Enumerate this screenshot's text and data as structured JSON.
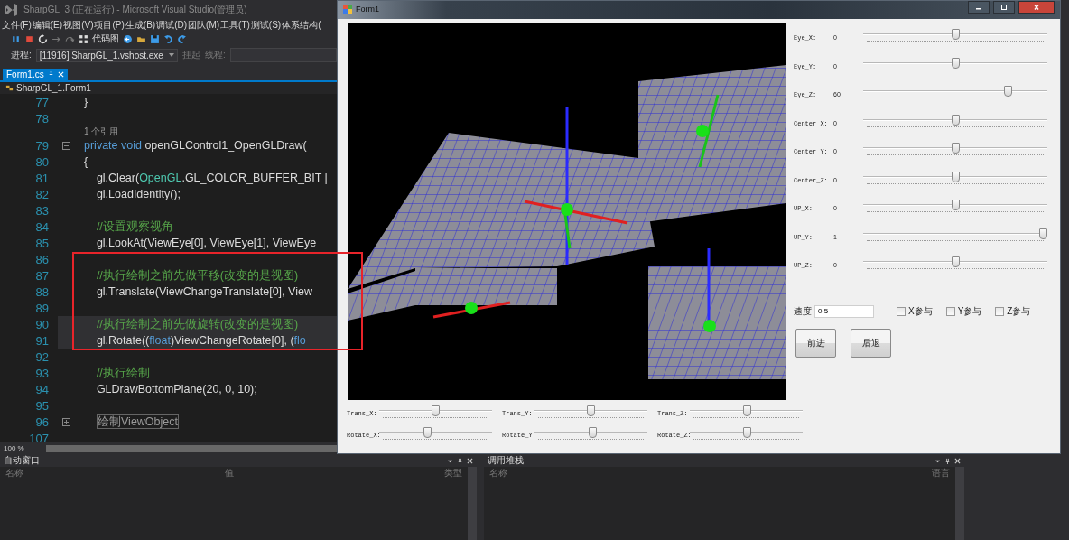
{
  "ide": {
    "title": "SharpGL_3 (正在运行) - Microsoft Visual Studio(管理员)",
    "menu": [
      "文件(F)",
      "编辑(E)",
      "视图(V)",
      "项目(P)",
      "生成(B)",
      "调试(D)",
      "团队(M)",
      "工具(T)",
      "测试(S)",
      "体系结构("
    ],
    "toolbar": {
      "code_map": "代码图"
    },
    "debug_bar": {
      "process_label": "进程:",
      "process": "[11916] SharpGL_1.vshost.exe",
      "suspend": "挂起",
      "thread_label": "线程:"
    },
    "tabs": [
      {
        "label": "Form1.cs",
        "selected": true
      }
    ],
    "breadcrumb": "SharpGL_1.Form1",
    "code_lines": [
      {
        "kind": "code",
        "number": "77",
        "highlighted": false,
        "tokens": [
          {
            "text": "}",
            "kind": "plain"
          }
        ]
      },
      {
        "kind": "code",
        "number": "78",
        "highlighted": false
      },
      {
        "kind": "codelens",
        "text": "1 个引用"
      },
      {
        "kind": "code",
        "number": "79",
        "collapsed": false,
        "highlighted": false,
        "tokens": [
          {
            "text": "private void",
            "kind": "keyword"
          },
          {
            "text": " openGLControl1_OpenGLDraw(",
            "kind": "plain"
          }
        ]
      },
      {
        "kind": "code",
        "number": "80",
        "highlighted": false,
        "tokens": [
          {
            "text": "{",
            "kind": "plain"
          }
        ]
      },
      {
        "kind": "code",
        "number": "81",
        "highlighted": false,
        "tokens": [
          {
            "text": "    gl.Clear(",
            "kind": "plain"
          },
          {
            "text": "OpenGL",
            "kind": "type"
          },
          {
            "text": ".GL_COLOR_BUFFER_BIT |",
            "kind": "plain"
          }
        ]
      },
      {
        "kind": "code",
        "number": "82",
        "highlighted": false,
        "tokens": [
          {
            "text": "    gl.LoadIdentity();",
            "kind": "plain"
          }
        ]
      },
      {
        "kind": "code",
        "number": "83",
        "highlighted": false
      },
      {
        "kind": "code",
        "number": "84",
        "highlighted": false,
        "tokens": [
          {
            "text": "    //设置观察视角",
            "kind": "comment"
          }
        ]
      },
      {
        "kind": "code",
        "number": "85",
        "highlighted": false,
        "tokens": [
          {
            "text": "    gl.LookAt(ViewEye[0], ViewEye[1], ViewEye",
            "kind": "plain"
          }
        ]
      },
      {
        "kind": "code",
        "number": "86",
        "highlighted": false
      },
      {
        "kind": "code",
        "number": "87",
        "highlighted": false,
        "tokens": [
          {
            "text": "    //执行绘制之前先做平移(改变的是视图)",
            "kind": "comment"
          }
        ]
      },
      {
        "kind": "code",
        "number": "88",
        "highlighted": false,
        "tokens": [
          {
            "text": "    gl.Translate(ViewChangeTranslate[0], View",
            "kind": "plain"
          }
        ]
      },
      {
        "kind": "code",
        "number": "89",
        "highlighted": false
      },
      {
        "kind": "code",
        "number": "90",
        "highlighted": true,
        "tokens": [
          {
            "text": "    //执行绘制之前先做旋转(改变的是视图)",
            "kind": "comment"
          }
        ]
      },
      {
        "kind": "code",
        "number": "91",
        "highlighted": true,
        "tokens": [
          {
            "text": "    gl.Rotate((",
            "kind": "plain"
          },
          {
            "text": "float",
            "kind": "keyword"
          },
          {
            "text": ")ViewChangeRotate[0], (",
            "kind": "plain"
          },
          {
            "text": "flo",
            "kind": "keyword"
          }
        ]
      },
      {
        "kind": "code",
        "number": "92",
        "highlighted": false
      },
      {
        "kind": "code",
        "number": "93",
        "highlighted": false,
        "tokens": [
          {
            "text": "    //执行绘制",
            "kind": "comment"
          }
        ]
      },
      {
        "kind": "code",
        "number": "94",
        "highlighted": false,
        "tokens": [
          {
            "text": "    GLDrawBottomPlane(20, 0, 10);",
            "kind": "plain"
          }
        ]
      },
      {
        "kind": "code",
        "number": "95",
        "highlighted": false
      },
      {
        "kind": "code",
        "number": "96",
        "collapsed": true,
        "highlighted": false,
        "tokens": [
          {
            "text": "绘制ViewObject",
            "kind": "collapsed"
          }
        ]
      },
      {
        "kind": "code",
        "number": "107",
        "highlighted": false
      }
    ],
    "zoom": "100 %",
    "panels": [
      {
        "title": "自动窗口",
        "columns": [
          "名称",
          "值",
          "类型"
        ]
      },
      {
        "title": "调用堆栈",
        "columns": [
          "名称",
          "语言"
        ]
      }
    ]
  },
  "form": {
    "title": "Form1",
    "camera_controls": [
      {
        "label": "Eye_X:",
        "value": "0",
        "level": 0.5
      },
      {
        "label": "Eye_Y:",
        "value": "0",
        "level": 0.5
      },
      {
        "label": "Eye_Z:",
        "value": "60",
        "level": 0.8
      },
      {
        "label": "Center_X:",
        "value": "0",
        "level": 0.5
      },
      {
        "label": "Center_Y:",
        "value": "0",
        "level": 0.5
      },
      {
        "label": "Center_Z:",
        "value": "0",
        "level": 0.5
      },
      {
        "label": "UP_X:",
        "value": "0",
        "level": 0.5
      },
      {
        "label": "UP_Y:",
        "value": "1",
        "level": 1
      },
      {
        "label": "UP_Z:",
        "value": "0",
        "level": 0.5
      }
    ],
    "speed": {
      "label": "速度",
      "value": "0.5"
    },
    "axis_checks": [
      {
        "label": "X参与",
        "checked": false
      },
      {
        "label": "Y参与",
        "checked": false
      },
      {
        "label": "Z参与",
        "checked": false
      }
    ],
    "buttons": [
      "前进",
      "后退"
    ],
    "transform_sliders": [
      {
        "label": "Trans_X:",
        "level": 0.5
      },
      {
        "label": "Trans_Y:",
        "level": 0.5
      },
      {
        "label": "Trans_Z:",
        "level": 0.51
      },
      {
        "label": "Rotate_X:",
        "level": 0.42
      },
      {
        "label": "Rotate_Y:",
        "level": 0.52
      },
      {
        "label": "Rotate_Z:",
        "level": 0.51
      }
    ]
  }
}
